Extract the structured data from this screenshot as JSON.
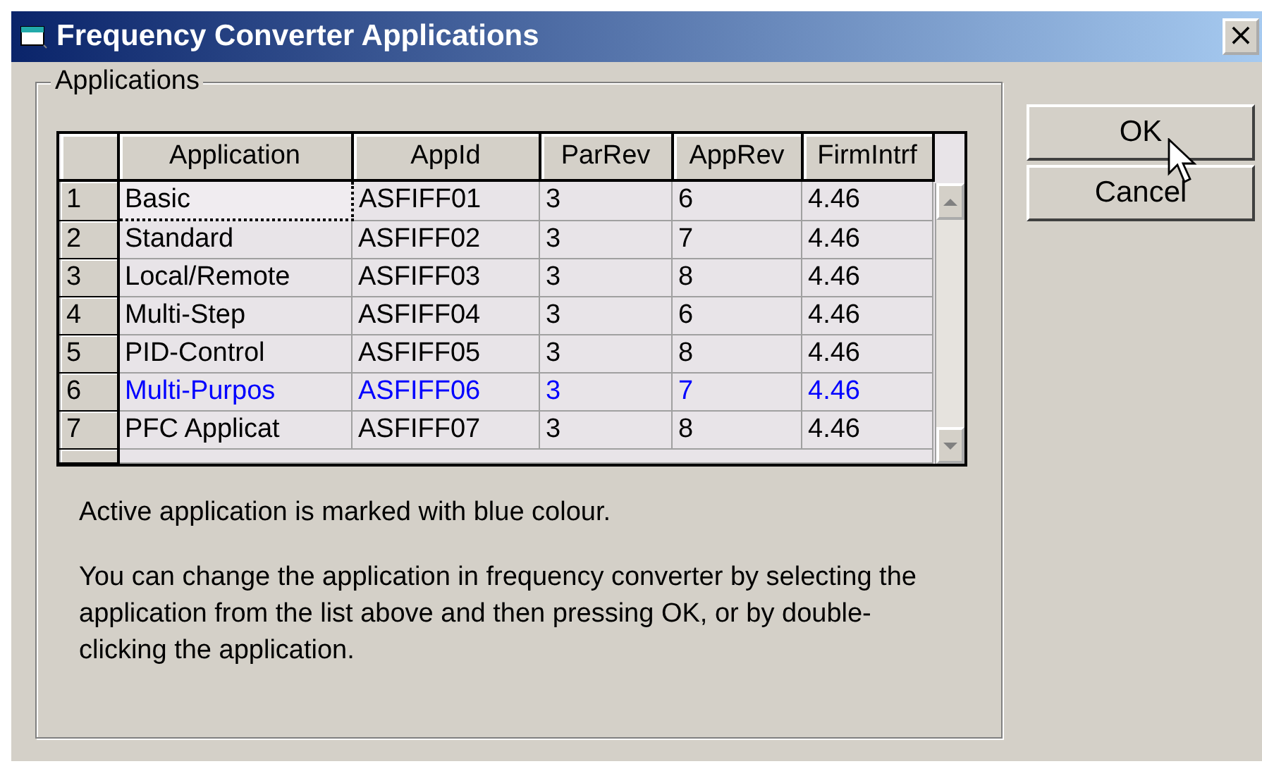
{
  "window": {
    "title": "Frequency Converter Applications",
    "close": "×"
  },
  "group": {
    "title": "Applications"
  },
  "table": {
    "columns": [
      "Application",
      "AppId",
      "ParRev",
      "AppRev",
      "FirmIntrf"
    ],
    "rows": [
      {
        "number": "1",
        "cells": [
          "Basic",
          "ASFIFF01",
          "3",
          "6",
          "4.46"
        ],
        "active": false,
        "focused": true
      },
      {
        "number": "2",
        "cells": [
          "Standard",
          "ASFIFF02",
          "3",
          "7",
          "4.46"
        ],
        "active": false,
        "focused": false
      },
      {
        "number": "3",
        "cells": [
          "Local/Remote",
          "ASFIFF03",
          "3",
          "8",
          "4.46"
        ],
        "active": false,
        "focused": false
      },
      {
        "number": "4",
        "cells": [
          "Multi-Step",
          "ASFIFF04",
          "3",
          "6",
          "4.46"
        ],
        "active": false,
        "focused": false
      },
      {
        "number": "5",
        "cells": [
          "PID-Control",
          "ASFIFF05",
          "3",
          "8",
          "4.46"
        ],
        "active": false,
        "focused": false
      },
      {
        "number": "6",
        "cells": [
          "Multi-Purpos",
          "ASFIFF06",
          "3",
          "7",
          "4.46"
        ],
        "active": true,
        "focused": false
      },
      {
        "number": "7",
        "cells": [
          "PFC Applicat",
          "ASFIFF07",
          "3",
          "8",
          "4.46"
        ],
        "active": false,
        "focused": false
      }
    ]
  },
  "notes": [
    "Active application is marked with blue colour.",
    "You can change the application in frequency converter by selecting the application from the list above and then pressing OK, or by double-clicking the application."
  ],
  "buttons": [
    "OK",
    "Cancel"
  ]
}
